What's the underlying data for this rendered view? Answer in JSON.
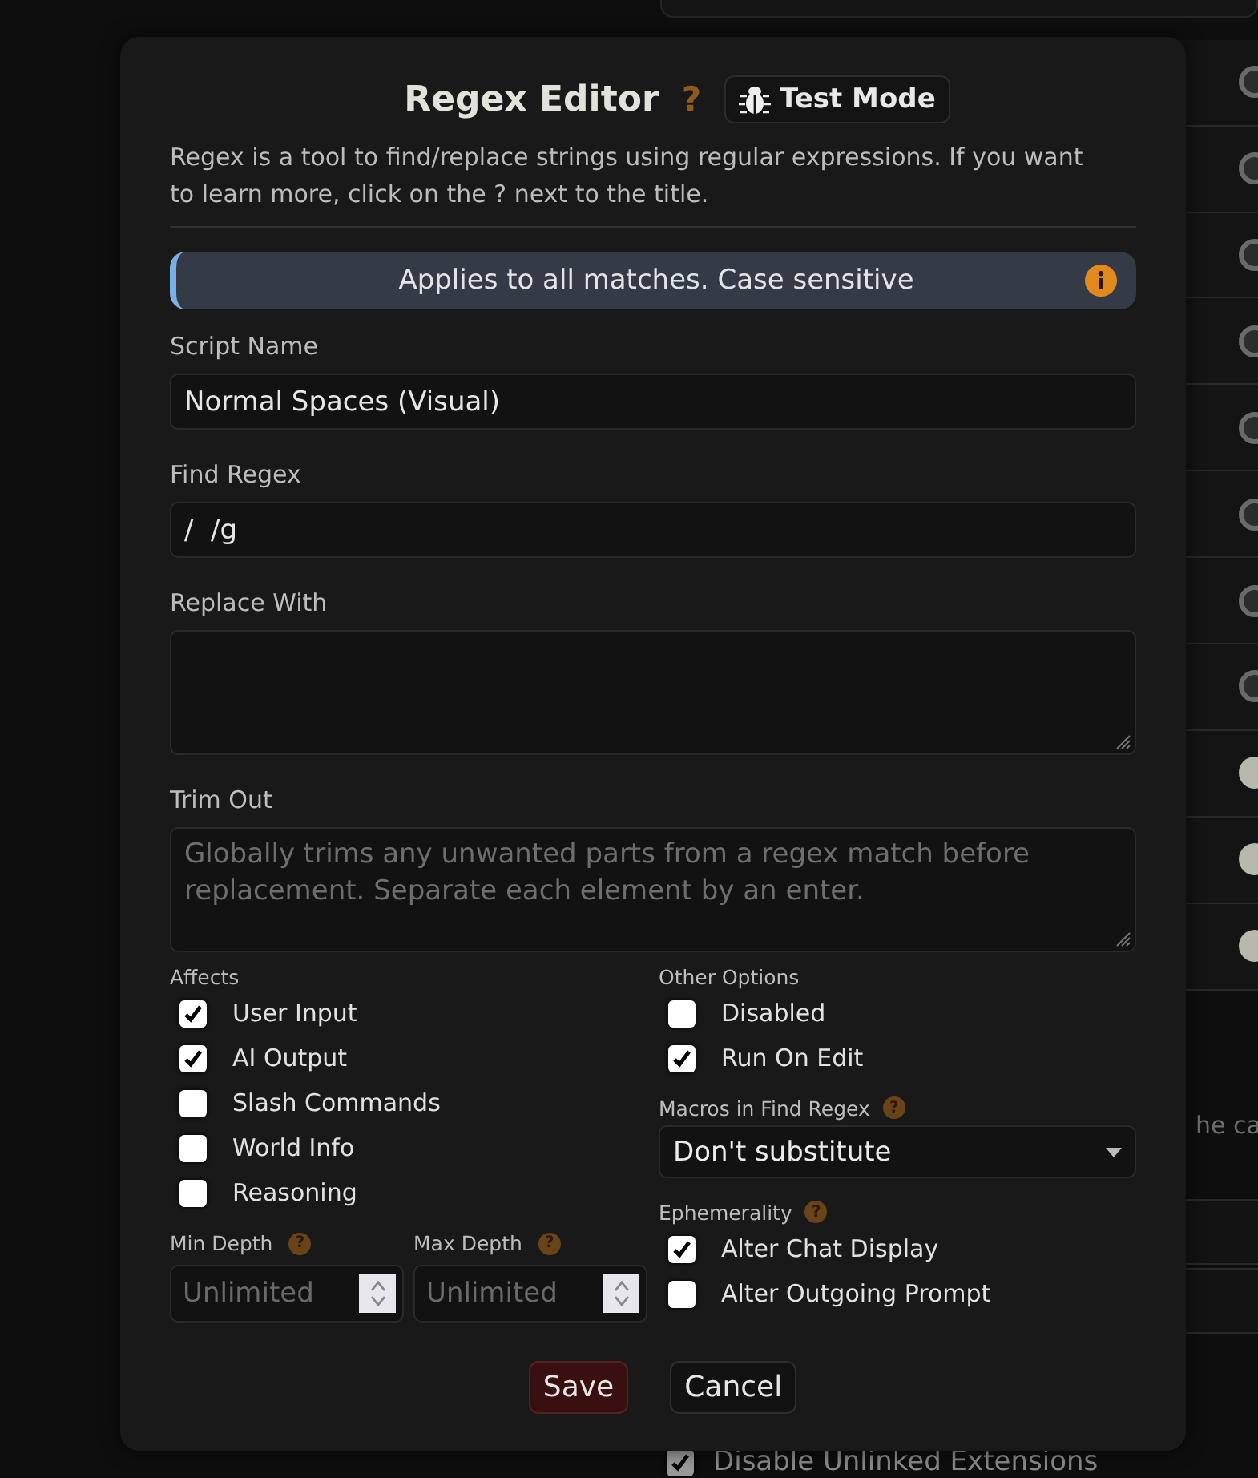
{
  "modal": {
    "title": "Regex Editor",
    "help": "?",
    "test_mode": "Test Mode",
    "description": "Regex is a tool to find/replace strings using regular expressions. If you want to learn more, click on the ? next to the title.",
    "notice": "Applies to all matches. Case sensitive",
    "fields": [
      {
        "label": "Script Name",
        "kind": "input",
        "value": "Normal Spaces (Visual)"
      },
      {
        "label": "Find Regex",
        "kind": "input",
        "value": "/  /g"
      },
      {
        "label": "Replace With",
        "kind": "textarea"
      },
      {
        "label": "Trim Out",
        "kind": "textarea",
        "placeholder": "Globally trims any unwanted parts from a regex match before replacement. Separate each element by an enter."
      }
    ],
    "affects": {
      "label": "Affects",
      "options": [
        {
          "label": "User Input",
          "checked": true
        },
        {
          "label": "AI Output",
          "checked": true
        },
        {
          "label": "Slash Commands",
          "checked": false
        },
        {
          "label": "World Info",
          "checked": false
        },
        {
          "label": "Reasoning",
          "checked": false
        }
      ]
    },
    "depth": [
      {
        "label": "Min Depth",
        "help": "?",
        "placeholder": "Unlimited"
      },
      {
        "label": "Max Depth",
        "help": "?",
        "placeholder": "Unlimited"
      }
    ],
    "other_options": {
      "label": "Other Options",
      "options": [
        {
          "label": "Disabled",
          "checked": false
        },
        {
          "label": "Run On Edit",
          "checked": true
        }
      ]
    },
    "macros": {
      "label": "Macros in Find Regex",
      "help": "?",
      "value": "Don't substitute"
    },
    "ephemerality": {
      "label": "Ephemerality",
      "help": "?",
      "options": [
        {
          "label": "Alter Chat Display",
          "checked": true
        },
        {
          "label": "Alter Outgoing Prompt",
          "checked": false
        }
      ]
    },
    "buttons": [
      {
        "label": "Save",
        "kind": "primary"
      },
      {
        "label": "Cancel",
        "kind": "secondary"
      }
    ]
  },
  "background": {
    "toggles": [
      {
        "on": false
      },
      {
        "on": false
      },
      {
        "on": false
      },
      {
        "on": false
      },
      {
        "on": false
      },
      {
        "on": false
      },
      {
        "on": false
      },
      {
        "on": false
      },
      {
        "on": true
      },
      {
        "on": true
      },
      {
        "on": true
      }
    ],
    "partial_text": "he ca",
    "extension_option": {
      "label": "Disable Unlinked Extensions",
      "checked": true
    }
  }
}
